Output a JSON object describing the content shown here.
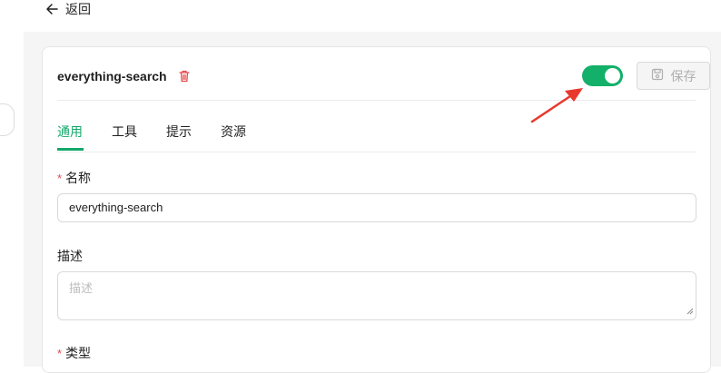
{
  "nav": {
    "back_label": "返回"
  },
  "plugin": {
    "name": "everything-search",
    "enabled": true
  },
  "toolbar": {
    "save_label": "保存"
  },
  "tabs": [
    {
      "label": "通用",
      "active": true
    },
    {
      "label": "工具",
      "active": false
    },
    {
      "label": "提示",
      "active": false
    },
    {
      "label": "资源",
      "active": false
    }
  ],
  "form": {
    "required_mark": "*",
    "name": {
      "label": "名称",
      "value": "everything-search"
    },
    "description": {
      "label": "描述",
      "placeholder": "描述"
    },
    "type": {
      "label": "类型"
    }
  },
  "colors": {
    "accent": "#13a86a",
    "toggle_on": "#13b06a",
    "required": "#e5484d",
    "annotation_arrow": "#e8392c"
  }
}
